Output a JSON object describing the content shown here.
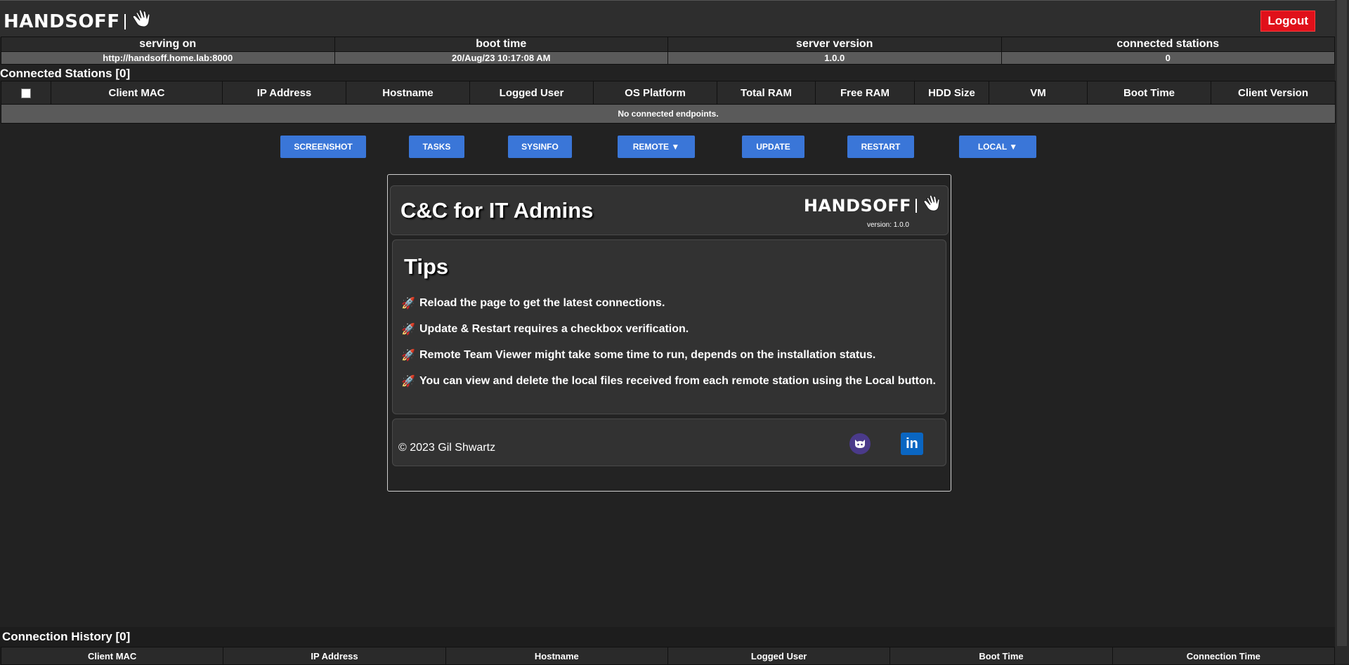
{
  "brand": {
    "name": "HANDSOFF",
    "hand_icon": "hand-icon"
  },
  "header": {
    "logout_label": "Logout",
    "logout_color": "#e0101a"
  },
  "server_info": {
    "headers": [
      "serving on",
      "boot time",
      "server version",
      "connected stations"
    ],
    "values": [
      "http://handsoff.home.lab:8000",
      "20/Aug/23 10:17:08 AM",
      "1.0.0",
      "0"
    ]
  },
  "stations": {
    "title": "Connected Stations [0]",
    "columns": [
      "Client MAC",
      "IP Address",
      "Hostname",
      "Logged User",
      "OS Platform",
      "Total RAM",
      "Free RAM",
      "HDD Size",
      "VM",
      "Boot Time",
      "Client Version"
    ],
    "empty_message": "No connected endpoints."
  },
  "actions": {
    "screenshot": "SCREENSHOT",
    "tasks": "TASKS",
    "sysinfo": "SYSINFO",
    "remote": "REMOTE ▼",
    "update": "UPDATE",
    "restart": "RESTART",
    "local": "LOCAL ▼",
    "button_color": "#3a76d8"
  },
  "card": {
    "headline": "C&C for IT Admins",
    "version_text": "version: 1.0.0",
    "tips_title": "Tips",
    "tips": [
      "Reload the page to get the latest connections.",
      "Update & Restart requires a checkbox verification.",
      "Remote Team Viewer might take some time to run, depends on the installation status.",
      "You can view and delete the local files received from each remote station using the Local button."
    ],
    "tip_icon": "rocket-icon",
    "copyright": "© 2023 Gil Shwartz",
    "github_icon": "github-icon",
    "linkedin_icon": "linkedin-icon",
    "linkedin_text": "in"
  },
  "history": {
    "title": "Connection History [0]",
    "columns": [
      "Client MAC",
      "IP Address",
      "Hostname",
      "Logged User",
      "Boot Time",
      "Connection Time"
    ]
  }
}
